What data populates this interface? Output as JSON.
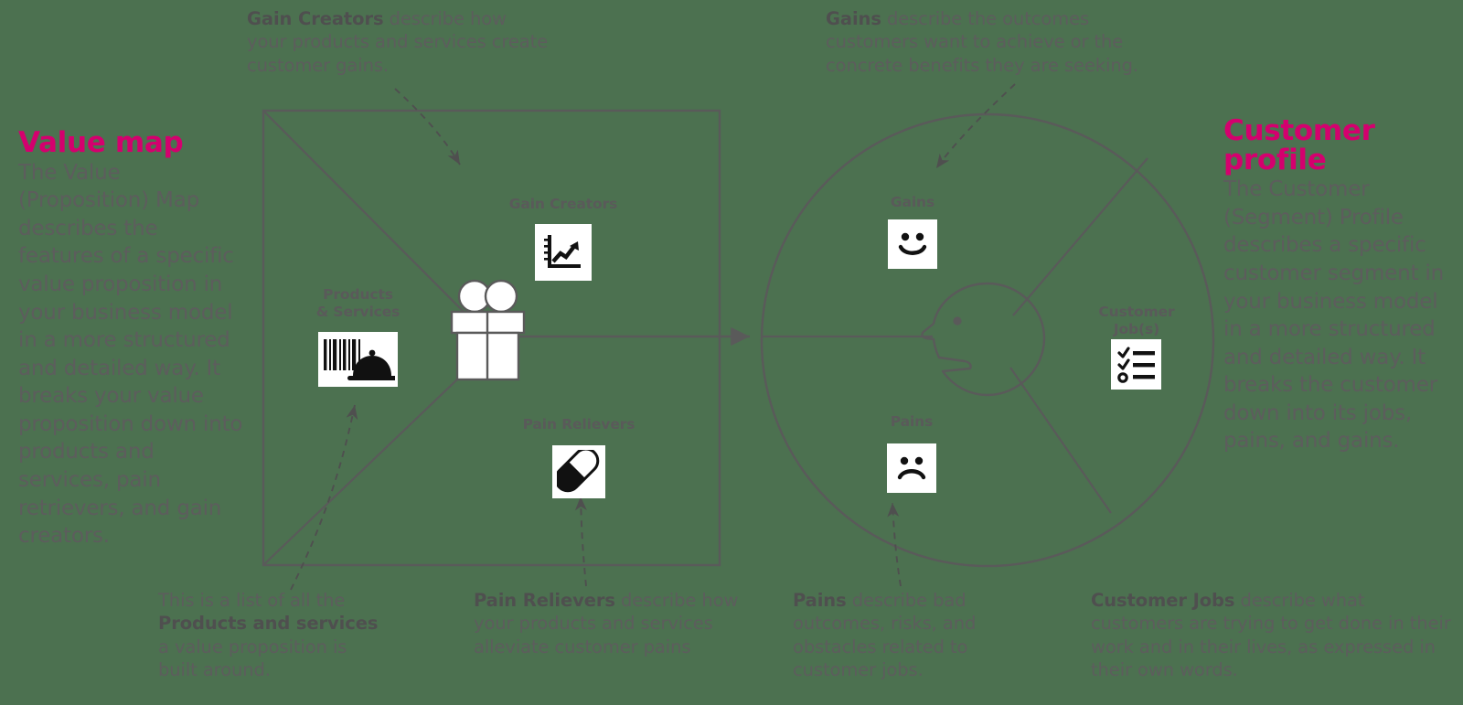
{
  "background_color": "#4c7150",
  "accent_color": "#d4006e",
  "text_color": "#5d5d5d",
  "line_color": "#5a5a5a",
  "left_column": {
    "title": "Value map",
    "body": "The Value (Proposition) Map describes the features of a specific value proposition in your business model in a more structured and detailed way. It breaks your value proposition down into products and services, pain retrievers, and gain creators."
  },
  "right_column": {
    "title": "Customer profile",
    "body": "The Customer (Segment) Profile describes a specific customer segment in your business model in a more structured and detailed way. It breaks the customer down into its jobs, pains, and gains."
  },
  "value_map": {
    "shape": "square",
    "segments": [
      {
        "label": "Gain Creators",
        "icon": "growth-chart-icon"
      },
      {
        "label": "Products\n& Services",
        "icon": "barcode-cloche-icon"
      },
      {
        "label": "Pain Relievers",
        "icon": "pill-capsule-icon"
      }
    ],
    "center_icon": "gift-box-icon"
  },
  "customer_profile": {
    "shape": "circle",
    "segments": [
      {
        "label": "Gains",
        "icon": "smiley-face-icon"
      },
      {
        "label": "Customer\nJob(s)",
        "icon": "checklist-icon"
      },
      {
        "label": "Pains",
        "icon": "sad-face-icon"
      }
    ],
    "center_icon": "customer-head-icon"
  },
  "notes": [
    {
      "id": "gain-creators-note",
      "bold": "Gain Creators",
      "rest": " describe how your products and services create customer gains."
    },
    {
      "id": "gains-note",
      "bold": "Gains",
      "rest": " describe the outcomes customers want to achieve or the concrete benefits they are seeking."
    },
    {
      "id": "products-services-note",
      "pre": "This is a list of all the ",
      "bold": "Products and services",
      "rest": " a value proposition is built around."
    },
    {
      "id": "pain-relievers-note",
      "bold": "Pain Relievers",
      "rest": " describe how your products and services alleviate customer pains"
    },
    {
      "id": "pains-note",
      "bold": "Pains",
      "rest": " describe bad outcomes, risks, and obstacles related to customer jobs."
    },
    {
      "id": "customer-jobs-note",
      "bold": "Customer Jobs",
      "rest": " describe what customers are trying to get done in their work and in their lives, as expressed in their own words."
    }
  ]
}
